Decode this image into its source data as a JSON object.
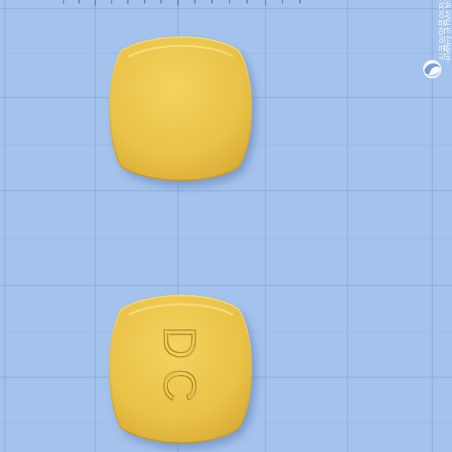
{
  "scene": {
    "background_color": "#a3c2ec",
    "grid_color": "#7f9fd6",
    "pill_color": "#f0c84a"
  },
  "watermark": {
    "korean_name": "식품의약품안전처",
    "english_name": "Ministry of Food and Drug",
    "logo_icon": "taegeuk-swirl-icon"
  },
  "pills": [
    {
      "side": "front",
      "imprint": ""
    },
    {
      "side": "back",
      "imprint": "DC"
    }
  ]
}
